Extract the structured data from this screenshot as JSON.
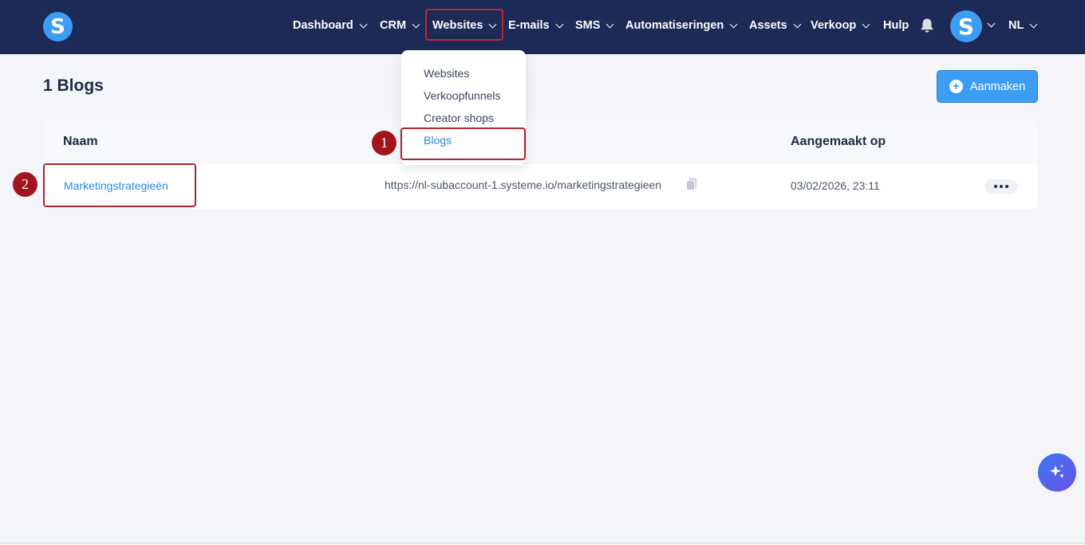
{
  "app": {
    "logo_letter": "S",
    "brand_color": "#3c9df3",
    "nav_bg": "#1b2a57"
  },
  "nav": {
    "items": [
      {
        "label": "Dashboard",
        "has_dropdown": true
      },
      {
        "label": "CRM",
        "has_dropdown": true
      },
      {
        "label": "Websites",
        "has_dropdown": true,
        "active": true
      },
      {
        "label": "E-mails",
        "has_dropdown": true
      },
      {
        "label": "SMS",
        "has_dropdown": true
      },
      {
        "label": "Automatiseringen",
        "has_dropdown": true
      },
      {
        "label": "Assets",
        "has_dropdown": true
      },
      {
        "label": "Verkoop",
        "has_dropdown": true
      },
      {
        "label": "Hulp",
        "has_dropdown": false
      }
    ],
    "notification_icon": "bell-icon",
    "avatar_letter": "S",
    "language": "NL"
  },
  "websites_menu": {
    "items": [
      {
        "label": "Websites"
      },
      {
        "label": "Verkoopfunnels"
      },
      {
        "label": "Creator shops"
      },
      {
        "label": "Blogs",
        "active": true
      }
    ]
  },
  "page": {
    "title": "1 Blogs",
    "create_label": "Aanmaken"
  },
  "table": {
    "columns": [
      "Naam",
      "",
      "Aangemaakt op"
    ],
    "rows": [
      {
        "name": "Marketingstrategieën",
        "url": "https://nl-subaccount-1.systeme.io/marketingstrategieen",
        "created": "03/02/2026, 23:11"
      }
    ]
  },
  "annotations": {
    "markers": [
      "1",
      "2"
    ],
    "highlight_color": "#a8262c"
  }
}
